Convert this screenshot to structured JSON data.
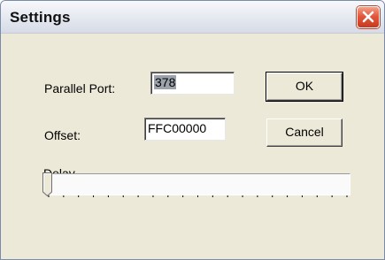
{
  "window": {
    "title": "Settings",
    "close_icon": "close-icon"
  },
  "fields": {
    "parallel_port_label": "Parallel Port:",
    "parallel_port_value": "378",
    "offset_label": "Offset:",
    "offset_value": "FFC00000"
  },
  "buttons": {
    "ok_label": "OK",
    "cancel_label": "Cancel"
  },
  "delay": {
    "label": "Delay",
    "level_fraction": 0.0,
    "tick_count": 21
  },
  "colors": {
    "close_button": "#d9482b",
    "dialog_background": "#ece9d8"
  }
}
